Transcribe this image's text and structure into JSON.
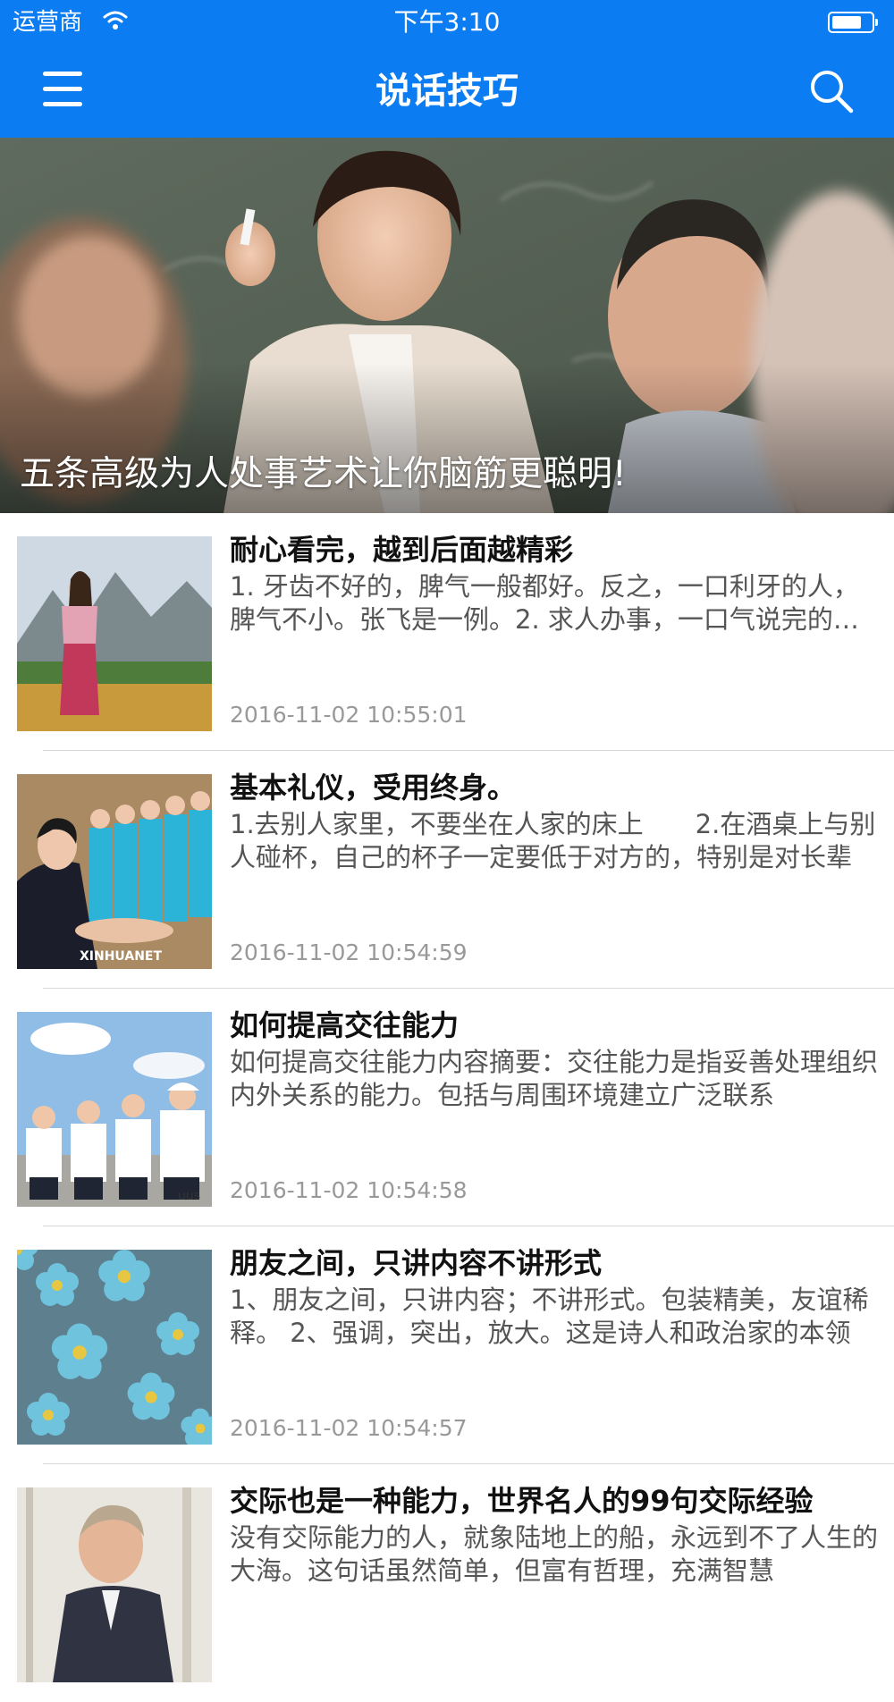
{
  "status_bar": {
    "carrier": "运营商",
    "time": "下午3:10"
  },
  "nav": {
    "title": "说话技巧",
    "menu_icon": "hamburger-menu-icon",
    "search_icon": "search-icon"
  },
  "banner": {
    "title": "五条高级为人处事艺术让你脑筋更聪明!"
  },
  "articles": [
    {
      "title": "耐心看完，越到后面越精彩",
      "summary": "1.  牙齿不好的，脾气一般都好。反之，一口利牙的人，脾气不小。张飞是一例。2.  求人办事，一口气说完的那种",
      "date": "2016-11-02 10:55:01"
    },
    {
      "title": "基本礼仪，受用终身。",
      "summary": "1.去别人家里，不要坐在人家的床上　　2.在酒桌上与别人碰杯，自己的杯子一定要低于对方的，特别是对长辈",
      "date": "2016-11-02 10:54:59"
    },
    {
      "title": "如何提高交往能力",
      "summary": "如何提高交往能力内容摘要：交往能力是指妥善处理组织内外关系的能力。包括与周围环境建立广泛联系",
      "date": "2016-11-02 10:54:58"
    },
    {
      "title": "朋友之间，只讲内容不讲形式",
      "summary": "1、朋友之间，只讲内容；不讲形式。包装精美，友谊稀释。 2、强调，突出，放大。这是诗人和政治家的本领",
      "date": "2016-11-02 10:54:57"
    },
    {
      "title": "交际也是一种能力，世界名人的99句交际经验",
      "summary": "没有交际能力的人，就象陆地上的船，永远到不了人生的大海。这句话虽然简单，但富有哲理，充满智慧",
      "date": ""
    }
  ],
  "colors": {
    "brand_blue": "#0b7cf2",
    "title_text": "#111111",
    "summary_text": "#555555",
    "date_text": "#999999"
  }
}
